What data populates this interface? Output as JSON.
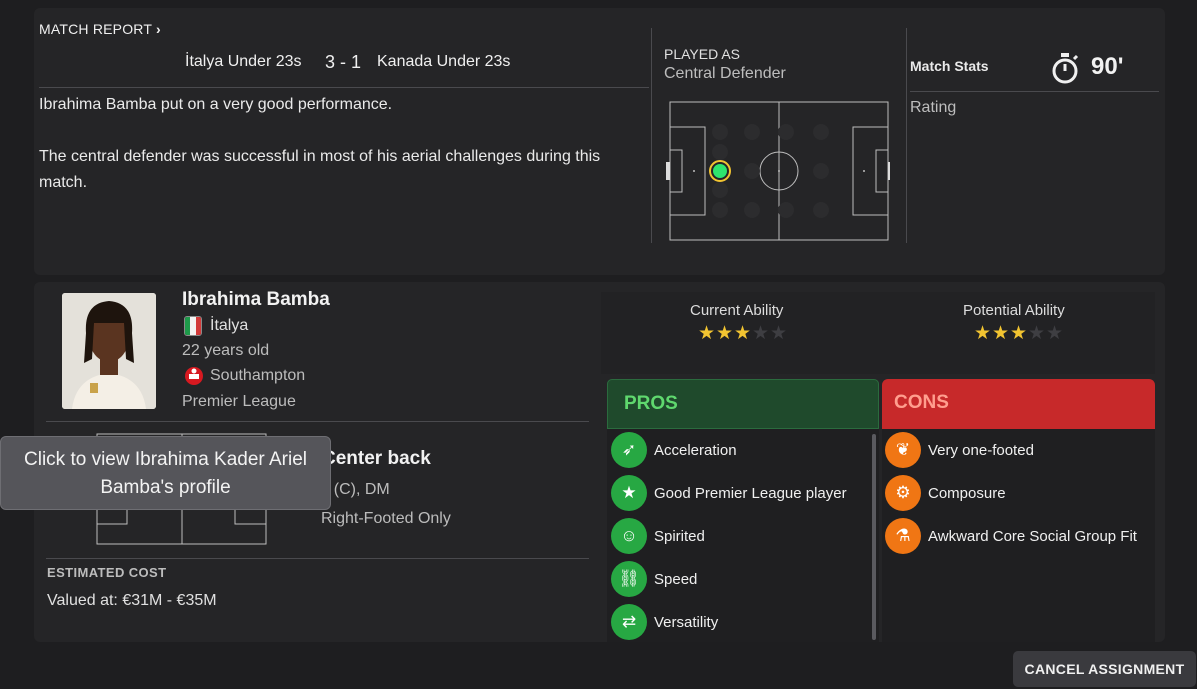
{
  "report": {
    "header_link": "MATCH REPORT",
    "home_team": "İtalya Under 23s",
    "score": "3 - 1",
    "away_team": "Kanada Under 23s",
    "paragraph_1": "Ibrahima Bamba put on a very good performance.",
    "paragraph_2": "The central defender was successful in most of his aerial challenges during this match."
  },
  "played_as": {
    "label": "PLAYED AS",
    "position": "Central Defender"
  },
  "match_stats": {
    "label": "Match Stats",
    "minutes": "90'",
    "rating_label": "Rating"
  },
  "player": {
    "name": "Ibrahima Bamba",
    "nation": "İtalya",
    "age": "22 years old",
    "club": "Southampton",
    "league": "Premier League",
    "role": "Center back",
    "positions_partial": ") (C), DM",
    "footedness": "Right-Footed Only"
  },
  "abilities": {
    "current_label": "Current Ability",
    "current_stars": 3,
    "potential_label": "Potential Ability",
    "potential_stars": 3,
    "max_stars": 5
  },
  "pros": {
    "title": "PROS",
    "items": [
      "Acceleration",
      "Good Premier League player",
      "Spirited",
      "Speed",
      "Versatility"
    ]
  },
  "cons": {
    "title": "CONS",
    "items": [
      "Very one-footed",
      "Composure",
      "Awkward Core Social Group Fit"
    ]
  },
  "cost": {
    "label": "ESTIMATED COST",
    "value": "Valued at: €31M - €35M"
  },
  "tooltip": {
    "text": "Click to view Ibrahima Kader Ariel Bamba's profile"
  },
  "actions": {
    "cancel_label": "CANCEL ASSIGNMENT"
  },
  "colors": {
    "pros_accent": "#5fd86e",
    "cons_bg": "#c7292a",
    "star": "#f2c431",
    "player_dot": "#2ee66e"
  }
}
